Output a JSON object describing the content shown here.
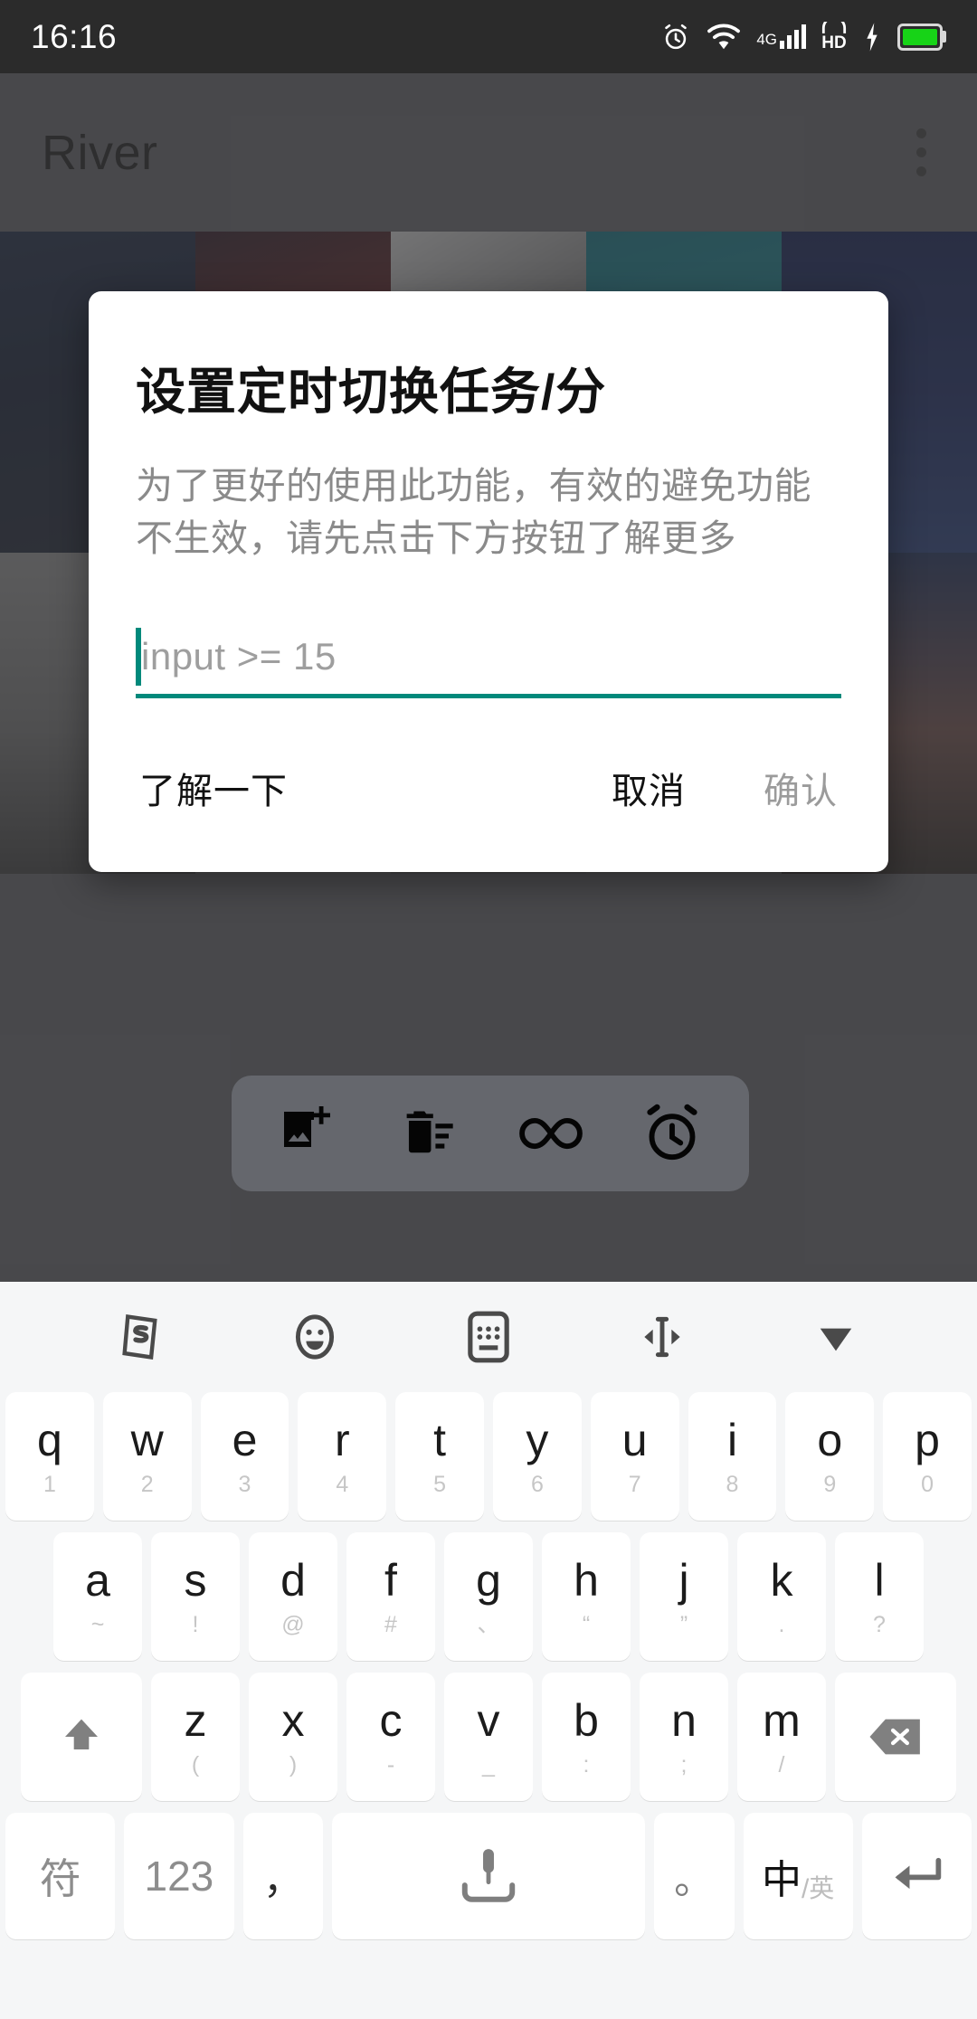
{
  "status_bar": {
    "time": "16:16",
    "icons": [
      "alarm-icon",
      "wifi-icon",
      "signal-4g-icon",
      "hd-icon",
      "charging-bolt-icon",
      "battery-icon"
    ],
    "network_label": "4G",
    "hd_label": "HD",
    "background_color": "#2b2b2b"
  },
  "app": {
    "title": "River",
    "overflow_menu_label": "more-options"
  },
  "dialog": {
    "title": "设置定时切换任务/分",
    "message": "为了更好的使用此功能，有效的避免功能不生效，请先点击下方按钮了解更多",
    "input": {
      "value": "",
      "placeholder": "input >= 15"
    },
    "accent_color": "#00897b",
    "buttons": {
      "learn": "了解一下",
      "cancel": "取消",
      "confirm": "确认"
    }
  },
  "bottom_toolbar": {
    "items": [
      {
        "name": "add-photo-icon",
        "label": "添加图片"
      },
      {
        "name": "delete-sweep-icon",
        "label": "删除"
      },
      {
        "name": "infinity-loop-icon",
        "label": "循环"
      },
      {
        "name": "alarm-clock-icon",
        "label": "定时"
      }
    ]
  },
  "keyboard": {
    "toolbar": [
      {
        "name": "sogou-logo-icon",
        "label": "S"
      },
      {
        "name": "emoji-icon",
        "label": "表情"
      },
      {
        "name": "keyboard-settings-icon",
        "label": "键盘设置"
      },
      {
        "name": "cursor-move-icon",
        "label": "移动光标"
      },
      {
        "name": "collapse-keyboard-icon",
        "label": "收起键盘"
      }
    ],
    "row1": [
      {
        "main": "q",
        "sub": "1"
      },
      {
        "main": "w",
        "sub": "2"
      },
      {
        "main": "e",
        "sub": "3"
      },
      {
        "main": "r",
        "sub": "4"
      },
      {
        "main": "t",
        "sub": "5"
      },
      {
        "main": "y",
        "sub": "6"
      },
      {
        "main": "u",
        "sub": "7"
      },
      {
        "main": "i",
        "sub": "8"
      },
      {
        "main": "o",
        "sub": "9"
      },
      {
        "main": "p",
        "sub": "0"
      }
    ],
    "row2": [
      {
        "main": "a",
        "sub": "~"
      },
      {
        "main": "s",
        "sub": "!"
      },
      {
        "main": "d",
        "sub": "@"
      },
      {
        "main": "f",
        "sub": "#"
      },
      {
        "main": "g",
        "sub": "、"
      },
      {
        "main": "h",
        "sub": "“"
      },
      {
        "main": "j",
        "sub": "”"
      },
      {
        "main": "k",
        "sub": "."
      },
      {
        "main": "l",
        "sub": "?"
      }
    ],
    "row3": [
      {
        "main": "z",
        "sub": "("
      },
      {
        "main": "x",
        "sub": ")"
      },
      {
        "main": "c",
        "sub": "-"
      },
      {
        "main": "v",
        "sub": "_"
      },
      {
        "main": "b",
        "sub": ":"
      },
      {
        "main": "n",
        "sub": ";"
      },
      {
        "main": "m",
        "sub": "/"
      }
    ],
    "shift_label": "shift-icon",
    "backspace_label": "backspace-icon",
    "row4": {
      "symbols": "符",
      "numbers": "123",
      "comma": "，",
      "space": "space-mic-icon",
      "period": "。",
      "lang_zh": "中",
      "lang_sep": "/",
      "lang_en": "英",
      "enter": "enter-icon"
    }
  }
}
